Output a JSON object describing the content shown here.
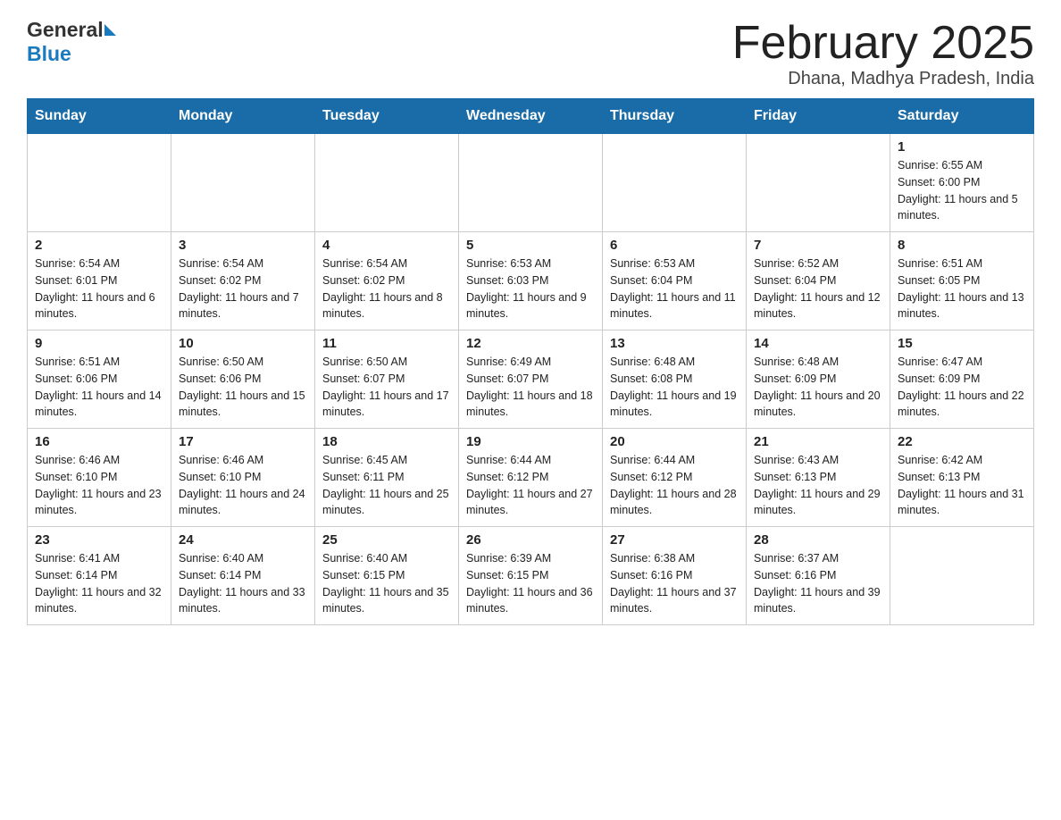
{
  "header": {
    "logo_general": "General",
    "logo_blue": "Blue",
    "month_title": "February 2025",
    "location": "Dhana, Madhya Pradesh, India"
  },
  "days_of_week": [
    "Sunday",
    "Monday",
    "Tuesday",
    "Wednesday",
    "Thursday",
    "Friday",
    "Saturday"
  ],
  "weeks": [
    [
      {
        "day": "",
        "sunrise": "",
        "sunset": "",
        "daylight": ""
      },
      {
        "day": "",
        "sunrise": "",
        "sunset": "",
        "daylight": ""
      },
      {
        "day": "",
        "sunrise": "",
        "sunset": "",
        "daylight": ""
      },
      {
        "day": "",
        "sunrise": "",
        "sunset": "",
        "daylight": ""
      },
      {
        "day": "",
        "sunrise": "",
        "sunset": "",
        "daylight": ""
      },
      {
        "day": "",
        "sunrise": "",
        "sunset": "",
        "daylight": ""
      },
      {
        "day": "1",
        "sunrise": "Sunrise: 6:55 AM",
        "sunset": "Sunset: 6:00 PM",
        "daylight": "Daylight: 11 hours and 5 minutes."
      }
    ],
    [
      {
        "day": "2",
        "sunrise": "Sunrise: 6:54 AM",
        "sunset": "Sunset: 6:01 PM",
        "daylight": "Daylight: 11 hours and 6 minutes."
      },
      {
        "day": "3",
        "sunrise": "Sunrise: 6:54 AM",
        "sunset": "Sunset: 6:02 PM",
        "daylight": "Daylight: 11 hours and 7 minutes."
      },
      {
        "day": "4",
        "sunrise": "Sunrise: 6:54 AM",
        "sunset": "Sunset: 6:02 PM",
        "daylight": "Daylight: 11 hours and 8 minutes."
      },
      {
        "day": "5",
        "sunrise": "Sunrise: 6:53 AM",
        "sunset": "Sunset: 6:03 PM",
        "daylight": "Daylight: 11 hours and 9 minutes."
      },
      {
        "day": "6",
        "sunrise": "Sunrise: 6:53 AM",
        "sunset": "Sunset: 6:04 PM",
        "daylight": "Daylight: 11 hours and 11 minutes."
      },
      {
        "day": "7",
        "sunrise": "Sunrise: 6:52 AM",
        "sunset": "Sunset: 6:04 PM",
        "daylight": "Daylight: 11 hours and 12 minutes."
      },
      {
        "day": "8",
        "sunrise": "Sunrise: 6:51 AM",
        "sunset": "Sunset: 6:05 PM",
        "daylight": "Daylight: 11 hours and 13 minutes."
      }
    ],
    [
      {
        "day": "9",
        "sunrise": "Sunrise: 6:51 AM",
        "sunset": "Sunset: 6:06 PM",
        "daylight": "Daylight: 11 hours and 14 minutes."
      },
      {
        "day": "10",
        "sunrise": "Sunrise: 6:50 AM",
        "sunset": "Sunset: 6:06 PM",
        "daylight": "Daylight: 11 hours and 15 minutes."
      },
      {
        "day": "11",
        "sunrise": "Sunrise: 6:50 AM",
        "sunset": "Sunset: 6:07 PM",
        "daylight": "Daylight: 11 hours and 17 minutes."
      },
      {
        "day": "12",
        "sunrise": "Sunrise: 6:49 AM",
        "sunset": "Sunset: 6:07 PM",
        "daylight": "Daylight: 11 hours and 18 minutes."
      },
      {
        "day": "13",
        "sunrise": "Sunrise: 6:48 AM",
        "sunset": "Sunset: 6:08 PM",
        "daylight": "Daylight: 11 hours and 19 minutes."
      },
      {
        "day": "14",
        "sunrise": "Sunrise: 6:48 AM",
        "sunset": "Sunset: 6:09 PM",
        "daylight": "Daylight: 11 hours and 20 minutes."
      },
      {
        "day": "15",
        "sunrise": "Sunrise: 6:47 AM",
        "sunset": "Sunset: 6:09 PM",
        "daylight": "Daylight: 11 hours and 22 minutes."
      }
    ],
    [
      {
        "day": "16",
        "sunrise": "Sunrise: 6:46 AM",
        "sunset": "Sunset: 6:10 PM",
        "daylight": "Daylight: 11 hours and 23 minutes."
      },
      {
        "day": "17",
        "sunrise": "Sunrise: 6:46 AM",
        "sunset": "Sunset: 6:10 PM",
        "daylight": "Daylight: 11 hours and 24 minutes."
      },
      {
        "day": "18",
        "sunrise": "Sunrise: 6:45 AM",
        "sunset": "Sunset: 6:11 PM",
        "daylight": "Daylight: 11 hours and 25 minutes."
      },
      {
        "day": "19",
        "sunrise": "Sunrise: 6:44 AM",
        "sunset": "Sunset: 6:12 PM",
        "daylight": "Daylight: 11 hours and 27 minutes."
      },
      {
        "day": "20",
        "sunrise": "Sunrise: 6:44 AM",
        "sunset": "Sunset: 6:12 PM",
        "daylight": "Daylight: 11 hours and 28 minutes."
      },
      {
        "day": "21",
        "sunrise": "Sunrise: 6:43 AM",
        "sunset": "Sunset: 6:13 PM",
        "daylight": "Daylight: 11 hours and 29 minutes."
      },
      {
        "day": "22",
        "sunrise": "Sunrise: 6:42 AM",
        "sunset": "Sunset: 6:13 PM",
        "daylight": "Daylight: 11 hours and 31 minutes."
      }
    ],
    [
      {
        "day": "23",
        "sunrise": "Sunrise: 6:41 AM",
        "sunset": "Sunset: 6:14 PM",
        "daylight": "Daylight: 11 hours and 32 minutes."
      },
      {
        "day": "24",
        "sunrise": "Sunrise: 6:40 AM",
        "sunset": "Sunset: 6:14 PM",
        "daylight": "Daylight: 11 hours and 33 minutes."
      },
      {
        "day": "25",
        "sunrise": "Sunrise: 6:40 AM",
        "sunset": "Sunset: 6:15 PM",
        "daylight": "Daylight: 11 hours and 35 minutes."
      },
      {
        "day": "26",
        "sunrise": "Sunrise: 6:39 AM",
        "sunset": "Sunset: 6:15 PM",
        "daylight": "Daylight: 11 hours and 36 minutes."
      },
      {
        "day": "27",
        "sunrise": "Sunrise: 6:38 AM",
        "sunset": "Sunset: 6:16 PM",
        "daylight": "Daylight: 11 hours and 37 minutes."
      },
      {
        "day": "28",
        "sunrise": "Sunrise: 6:37 AM",
        "sunset": "Sunset: 6:16 PM",
        "daylight": "Daylight: 11 hours and 39 minutes."
      },
      {
        "day": "",
        "sunrise": "",
        "sunset": "",
        "daylight": ""
      }
    ]
  ]
}
